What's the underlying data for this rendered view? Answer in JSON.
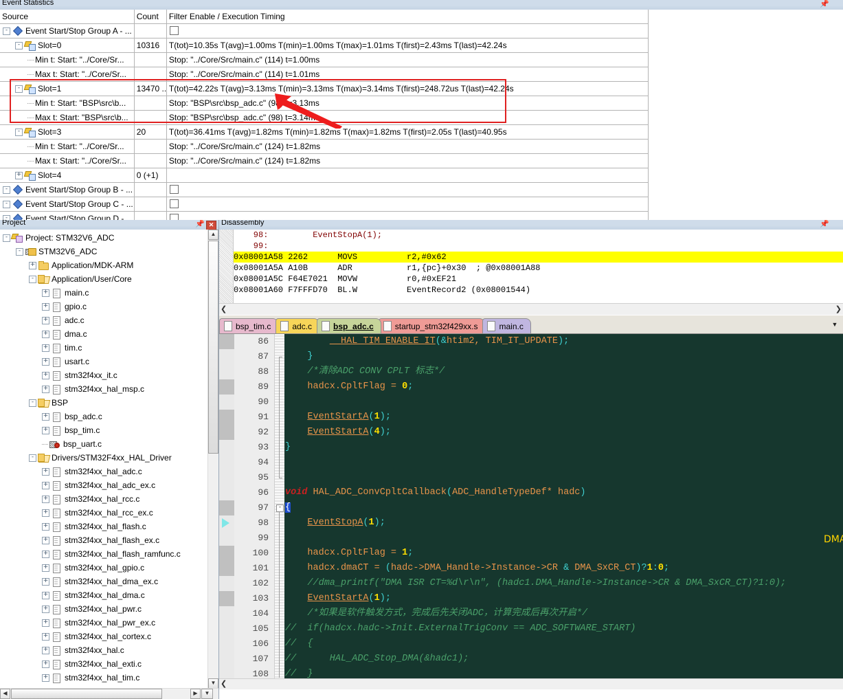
{
  "event_statistics": {
    "title": "Event Statistics",
    "pin_icon": "pin-icon",
    "columns": [
      "Source",
      "Count",
      "Filter Enable / Execution Timing"
    ],
    "rows": [
      {
        "level": 0,
        "icon": "diamond-icon",
        "expander": "-",
        "source": "Event Start/Stop Group A - ...",
        "count": "",
        "timing": "",
        "checkbox": true
      },
      {
        "level": 1,
        "icon": "slot-icon",
        "expander": "-",
        "source": "Slot=0",
        "count": "10316",
        "timing": "T(tot)=10.35s T(avg)=1.00ms T(min)=1.00ms T(max)=1.01ms T(first)=2.43ms T(last)=42.24s",
        "checkbox": false
      },
      {
        "level": 2,
        "icon": "",
        "expander": "",
        "source": "Min t: Start: \"../Core/Sr...",
        "count": "",
        "timing": "Stop: \"../Core/Src/main.c\" (114) t=1.00ms",
        "checkbox": false
      },
      {
        "level": 2,
        "icon": "",
        "expander": "",
        "source": "Max t: Start: \"../Core/Sr...",
        "count": "",
        "timing": "Stop: \"../Core/Src/main.c\" (114) t=1.01ms",
        "checkbox": false
      },
      {
        "level": 1,
        "icon": "slot-icon",
        "expander": "-",
        "source": "Slot=1",
        "count": "13470 ...",
        "timing": "T(tot)=42.22s T(avg)=3.13ms T(min)=3.13ms T(max)=3.14ms T(first)=248.72us T(last)=42.24s",
        "checkbox": false
      },
      {
        "level": 2,
        "icon": "",
        "expander": "",
        "source": "Min t: Start: \"BSP\\src\\b...",
        "count": "",
        "timing": "Stop: \"BSP\\src\\bsp_adc.c\" (98) t=3.13ms",
        "checkbox": false
      },
      {
        "level": 2,
        "icon": "",
        "expander": "",
        "source": "Max t: Start: \"BSP\\src\\b...",
        "count": "",
        "timing": "Stop: \"BSP\\src\\bsp_adc.c\" (98) t=3.14ms",
        "checkbox": false
      },
      {
        "level": 1,
        "icon": "slot-icon",
        "expander": "-",
        "source": "Slot=3",
        "count": "20",
        "timing": "T(tot)=36.41ms T(avg)=1.82ms T(min)=1.82ms T(max)=1.82ms T(first)=2.05s T(last)=40.95s",
        "checkbox": false
      },
      {
        "level": 2,
        "icon": "",
        "expander": "",
        "source": "Min t: Start: \"../Core/Sr...",
        "count": "",
        "timing": "Stop: \"../Core/Src/main.c\" (124) t=1.82ms",
        "checkbox": false
      },
      {
        "level": 2,
        "icon": "",
        "expander": "",
        "source": "Max t: Start: \"../Core/Sr...",
        "count": "",
        "timing": "Stop: \"../Core/Src/main.c\" (124) t=1.82ms",
        "checkbox": false
      },
      {
        "level": 1,
        "icon": "slot-icon",
        "expander": "+",
        "source": "Slot=4",
        "count": "0 (+1)",
        "timing": "",
        "checkbox": false
      },
      {
        "level": 0,
        "icon": "diamond-icon",
        "expander": "-",
        "source": "Event Start/Stop Group B - ...",
        "count": "",
        "timing": "",
        "checkbox": true
      },
      {
        "level": 0,
        "icon": "diamond-icon",
        "expander": "-",
        "source": "Event Start/Stop Group C - ...",
        "count": "",
        "timing": "",
        "checkbox": true
      },
      {
        "level": 0,
        "icon": "diamond-icon",
        "expander": "-",
        "source": "Event Start/Stop Group D - ...",
        "count": "",
        "timing": "",
        "checkbox": true
      }
    ],
    "highlight_color": "#e02020"
  },
  "project": {
    "title": "Project",
    "pin_icon": "pin-icon",
    "close_icon": "close-icon",
    "tree": [
      {
        "level": 0,
        "exp": "-",
        "icon": "project-icon",
        "label": "Project: STM32V6_ADC"
      },
      {
        "level": 1,
        "exp": "-",
        "icon": "target-icon",
        "label": "STM32V6_ADC"
      },
      {
        "level": 2,
        "exp": "+",
        "icon": "folder-icon",
        "label": "Application/MDK-ARM"
      },
      {
        "level": 2,
        "exp": "-",
        "icon": "folder-open-icon",
        "label": "Application/User/Core"
      },
      {
        "level": 3,
        "exp": "+",
        "icon": "file-icon",
        "label": "main.c"
      },
      {
        "level": 3,
        "exp": "+",
        "icon": "file-icon",
        "label": "gpio.c"
      },
      {
        "level": 3,
        "exp": "+",
        "icon": "file-icon",
        "label": "adc.c"
      },
      {
        "level": 3,
        "exp": "+",
        "icon": "file-icon",
        "label": "dma.c"
      },
      {
        "level": 3,
        "exp": "+",
        "icon": "file-icon",
        "label": "tim.c"
      },
      {
        "level": 3,
        "exp": "+",
        "icon": "file-icon",
        "label": "usart.c"
      },
      {
        "level": 3,
        "exp": "+",
        "icon": "file-icon",
        "label": "stm32f4xx_it.c"
      },
      {
        "level": 3,
        "exp": "+",
        "icon": "file-icon",
        "label": "stm32f4xx_hal_msp.c"
      },
      {
        "level": 2,
        "exp": "-",
        "icon": "folder-open-icon",
        "label": "BSP"
      },
      {
        "level": 3,
        "exp": "+",
        "icon": "file-icon",
        "label": "bsp_adc.c"
      },
      {
        "level": 3,
        "exp": "+",
        "icon": "file-icon",
        "label": "bsp_tim.c"
      },
      {
        "level": 3,
        "exp": "",
        "icon": "file-excluded-icon",
        "label": "bsp_uart.c"
      },
      {
        "level": 2,
        "exp": "-",
        "icon": "folder-open-icon",
        "label": "Drivers/STM32F4xx_HAL_Driver"
      },
      {
        "level": 3,
        "exp": "+",
        "icon": "file-icon",
        "label": "stm32f4xx_hal_adc.c"
      },
      {
        "level": 3,
        "exp": "+",
        "icon": "file-icon",
        "label": "stm32f4xx_hal_adc_ex.c"
      },
      {
        "level": 3,
        "exp": "+",
        "icon": "file-icon",
        "label": "stm32f4xx_hal_rcc.c"
      },
      {
        "level": 3,
        "exp": "+",
        "icon": "file-icon",
        "label": "stm32f4xx_hal_rcc_ex.c"
      },
      {
        "level": 3,
        "exp": "+",
        "icon": "file-icon",
        "label": "stm32f4xx_hal_flash.c"
      },
      {
        "level": 3,
        "exp": "+",
        "icon": "file-icon",
        "label": "stm32f4xx_hal_flash_ex.c"
      },
      {
        "level": 3,
        "exp": "+",
        "icon": "file-icon",
        "label": "stm32f4xx_hal_flash_ramfunc.c"
      },
      {
        "level": 3,
        "exp": "+",
        "icon": "file-icon",
        "label": "stm32f4xx_hal_gpio.c"
      },
      {
        "level": 3,
        "exp": "+",
        "icon": "file-icon",
        "label": "stm32f4xx_hal_dma_ex.c"
      },
      {
        "level": 3,
        "exp": "+",
        "icon": "file-icon",
        "label": "stm32f4xx_hal_dma.c"
      },
      {
        "level": 3,
        "exp": "+",
        "icon": "file-icon",
        "label": "stm32f4xx_hal_pwr.c"
      },
      {
        "level": 3,
        "exp": "+",
        "icon": "file-icon",
        "label": "stm32f4xx_hal_pwr_ex.c"
      },
      {
        "level": 3,
        "exp": "+",
        "icon": "file-icon",
        "label": "stm32f4xx_hal_cortex.c"
      },
      {
        "level": 3,
        "exp": "+",
        "icon": "file-icon",
        "label": "stm32f4xx_hal.c"
      },
      {
        "level": 3,
        "exp": "+",
        "icon": "file-icon",
        "label": "stm32f4xx_hal_exti.c"
      },
      {
        "level": 3,
        "exp": "+",
        "icon": "file-icon",
        "label": "stm32f4xx_hal_tim.c"
      }
    ]
  },
  "disassembly": {
    "title": "Disassembly",
    "pin_icon": "pin-icon",
    "lines": [
      {
        "type": "src",
        "text": "    98:         EventStopA(1);"
      },
      {
        "type": "src",
        "text": "    99:"
      },
      {
        "type": "asm",
        "highlight": true,
        "text": "0x08001A58 2262      MOVS          r2,#0x62"
      },
      {
        "type": "asm",
        "highlight": false,
        "text": "0x08001A5A A10B      ADR           r1,{pc}+0x30  ; @0x08001A88"
      },
      {
        "type": "asm",
        "highlight": false,
        "text": "0x08001A5C F64E7021  MOVW          r0,#0xEF21"
      },
      {
        "type": "asm",
        "highlight": false,
        "text": "0x08001A60 F7FFFD70  BL.W          EventRecord2 (0x08001544)"
      }
    ]
  },
  "editor": {
    "tabs": [
      {
        "label": "bsp_tim.c",
        "color": "#e7b9cd",
        "active": false
      },
      {
        "label": "adc.c",
        "color": "#f7d559",
        "active": false
      },
      {
        "label": "bsp_adc.c",
        "color": "#c6d49a",
        "active": true
      },
      {
        "label": "startup_stm32f429xx.s",
        "color": "#ef9b96",
        "active": false
      },
      {
        "label": "main.c",
        "color": "#c0b6e0",
        "active": false
      }
    ],
    "dropdown_icon": "chevron-down-icon",
    "first_line_number": 86,
    "lines": [
      {
        "n": 86,
        "html": "        <span class=\"k-fn\">__HAL_TIM_ENABLE_IT</span><span class=\"k-punc\">(</span><span class=\"k-amp\">&amp;</span>htim2, TIM_IT_UPDATE<span class=\"k-punc\">);</span>"
      },
      {
        "n": 87,
        "html": "    <span class=\"k-brace\">}</span>"
      },
      {
        "n": 88,
        "html": "    <span class=\"k-cmt\">/*清除ADC CONV CPLT 标志*/</span>"
      },
      {
        "n": 89,
        "html": "    hadcx.CpltFlag = <span class=\"k-num\">0</span><span class=\"k-punc\">;</span>"
      },
      {
        "n": 90,
        "html": ""
      },
      {
        "n": 91,
        "html": "    <span class=\"k-fn\">EventStartA</span><span class=\"k-punc\">(</span><span class=\"k-num\">1</span><span class=\"k-punc\">);</span>"
      },
      {
        "n": 92,
        "html": "    <span class=\"k-fn\">EventStartA</span><span class=\"k-punc\">(</span><span class=\"k-num\">4</span><span class=\"k-punc\">);</span>"
      },
      {
        "n": 93,
        "html": "<span class=\"k-brace\">}</span>"
      },
      {
        "n": 94,
        "html": ""
      },
      {
        "n": 95,
        "html": ""
      },
      {
        "n": 96,
        "html": "<span class=\"k-key\">void</span> HAL_ADC_ConvCpltCallback<span class=\"k-punc\">(</span>ADC_HandleTypeDef* hadc<span class=\"k-punc\">)</span>"
      },
      {
        "n": 97,
        "html": "<span class=\"sel-brace\">{</span>"
      },
      {
        "n": 98,
        "html": "    <span class=\"k-fn\">EventStopA</span><span class=\"k-punc\">(</span><span class=\"k-num\">1</span><span class=\"k-punc\">);</span>"
      },
      {
        "n": 99,
        "html": ""
      },
      {
        "n": 100,
        "html": "    hadcx.CpltFlag = <span class=\"k-num\">1</span><span class=\"k-punc\">;</span>"
      },
      {
        "n": 101,
        "html": "    hadcx.dmaCT = <span class=\"k-punc\">(</span>hadc-&gt;DMA_Handle-&gt;Instance-&gt;CR <span class=\"k-amp\">&amp;</span> DMA_SxCR_CT<span class=\"k-punc\">)?</span><span class=\"k-num\">1</span><span class=\"k-punc\">:</span><span class=\"k-num\">0</span><span class=\"k-punc\">;</span>"
      },
      {
        "n": 102,
        "html": "    <span class=\"k-cmt\">//dma_printf(\"DMA ISR CT=%d\\r\\n\", (hadc1.DMA_Handle-&gt;Instance-&gt;CR &amp; DMA_SxCR_CT)?1:0);</span>"
      },
      {
        "n": 103,
        "html": "    <span class=\"k-fn\">EventStartA</span><span class=\"k-punc\">(</span><span class=\"k-num\">1</span><span class=\"k-punc\">);</span>"
      },
      {
        "n": 104,
        "html": "    <span class=\"k-cmt\">/*如果是软件触发方式，完成后先关闭ADC，计算完成后再次开启*/</span>"
      },
      {
        "n": 105,
        "html": "<span class=\"k-cmt\">//  if(hadcx.hadc-&gt;Init.ExternalTrigConv == ADC_SOFTWARE_START)</span>"
      },
      {
        "n": 106,
        "html": "<span class=\"k-cmt\">//  {</span>"
      },
      {
        "n": 107,
        "html": "<span class=\"k-cmt\">//      HAL_ADC_Stop_DMA(&amp;hadc1);</span>"
      },
      {
        "n": 108,
        "html": "<span class=\"k-cmt\">//  }</span>"
      }
    ],
    "annotation": "DMA双Buffer需要 其他模式可以不用",
    "annotation_color": "#ffd400",
    "arrow_color": "#ee1d1d"
  }
}
